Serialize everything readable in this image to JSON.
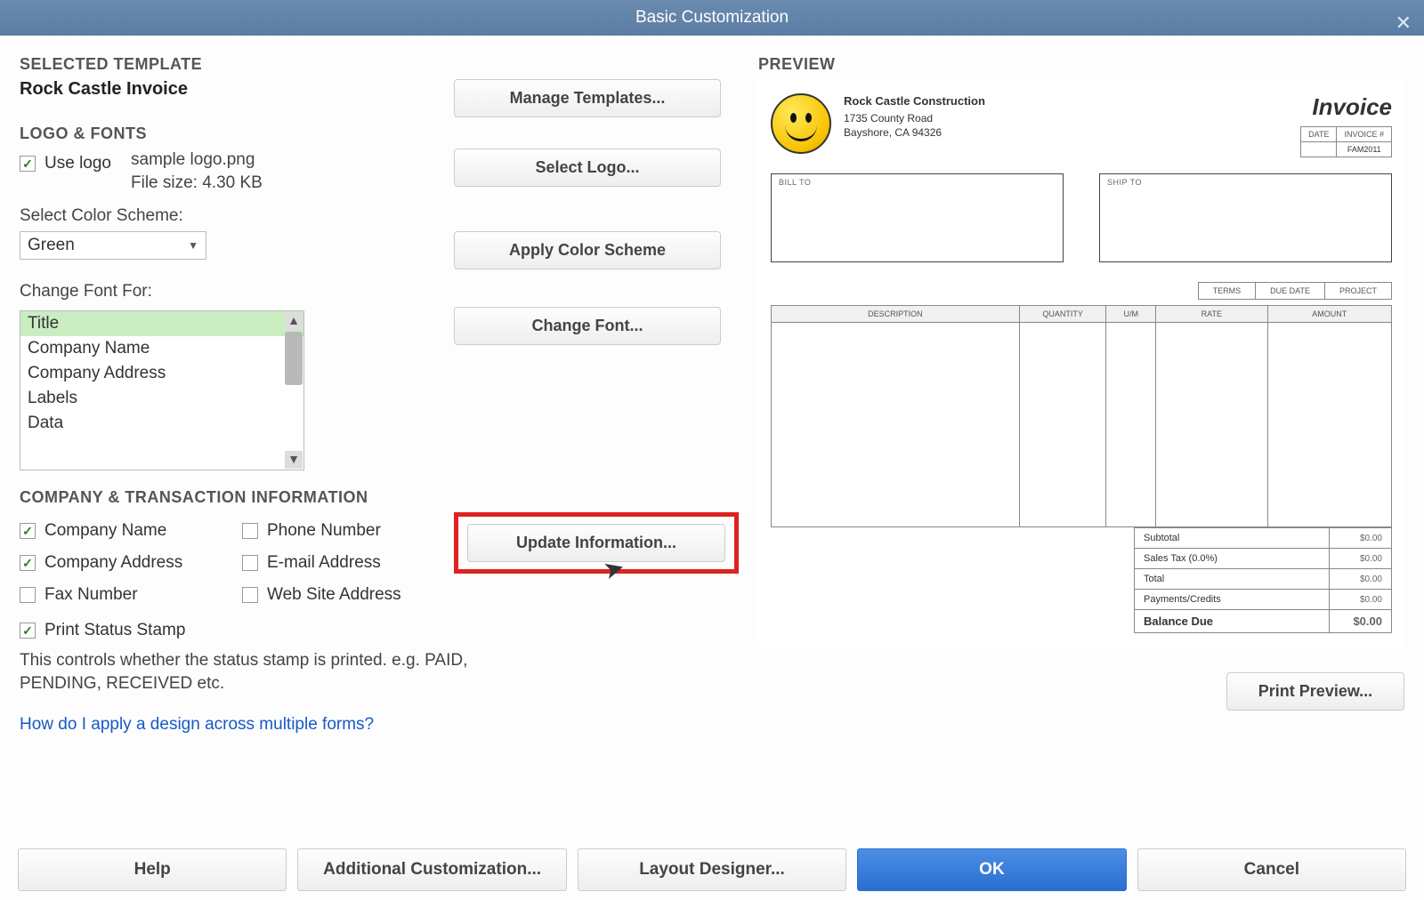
{
  "window": {
    "title": "Basic Customization"
  },
  "template": {
    "heading": "SELECTED TEMPLATE",
    "name": "Rock Castle Invoice",
    "manage_btn": "Manage Templates..."
  },
  "logo_fonts": {
    "heading": "LOGO & FONTS",
    "use_logo_label": "Use logo",
    "use_logo_checked": true,
    "logo_filename": "sample logo.png",
    "logo_filesize": "File size: 4.30 KB",
    "select_logo_btn": "Select Logo...",
    "color_scheme_label": "Select Color Scheme:",
    "color_scheme_value": "Green",
    "apply_color_btn": "Apply Color Scheme",
    "change_font_label": "Change Font For:",
    "font_items": [
      "Title",
      "Company Name",
      "Company Address",
      "Labels",
      "Data"
    ],
    "font_selected_index": 0,
    "change_font_btn": "Change Font..."
  },
  "company_info": {
    "heading": "COMPANY & TRANSACTION INFORMATION",
    "checks": [
      {
        "label": "Company Name",
        "checked": true
      },
      {
        "label": "Phone Number",
        "checked": false
      },
      {
        "label": "Company Address",
        "checked": true
      },
      {
        "label": "E-mail Address",
        "checked": false
      },
      {
        "label": "Fax Number",
        "checked": false
      },
      {
        "label": "Web Site Address",
        "checked": false
      }
    ],
    "update_btn": "Update Information...",
    "print_status_label": "Print Status Stamp",
    "print_status_checked": true,
    "status_desc": "This controls whether the status stamp is printed. e.g. PAID, PENDING, RECEIVED etc."
  },
  "help_link": "How do I apply a design across multiple forms?",
  "preview": {
    "heading": "PREVIEW",
    "company_name": "Rock Castle Construction",
    "addr1": "1735 County Road",
    "addr2": "Bayshore, CA 94326",
    "doc_title": "Invoice",
    "date_hdr": "DATE",
    "invno_hdr": "INVOICE #",
    "invno_val": "FAM2011",
    "billto": "BILL TO",
    "shipto": "SHIP TO",
    "terms_hdrs": [
      "TERMS",
      "DUE DATE",
      "PROJECT"
    ],
    "line_hdrs": [
      "DESCRIPTION",
      "QUANTITY",
      "U/M",
      "RATE",
      "AMOUNT"
    ],
    "totals": [
      {
        "label": "Subtotal",
        "amt": "$0.00"
      },
      {
        "label": "Sales Tax  (0.0%)",
        "amt": "$0.00"
      },
      {
        "label": "Total",
        "amt": "$0.00"
      },
      {
        "label": "Payments/Credits",
        "amt": "$0.00"
      },
      {
        "label": "Balance Due",
        "amt": "$0.00"
      }
    ],
    "print_preview_btn": "Print Preview..."
  },
  "bottom": {
    "help": "Help",
    "additional": "Additional Customization...",
    "layout": "Layout Designer...",
    "ok": "OK",
    "cancel": "Cancel"
  }
}
